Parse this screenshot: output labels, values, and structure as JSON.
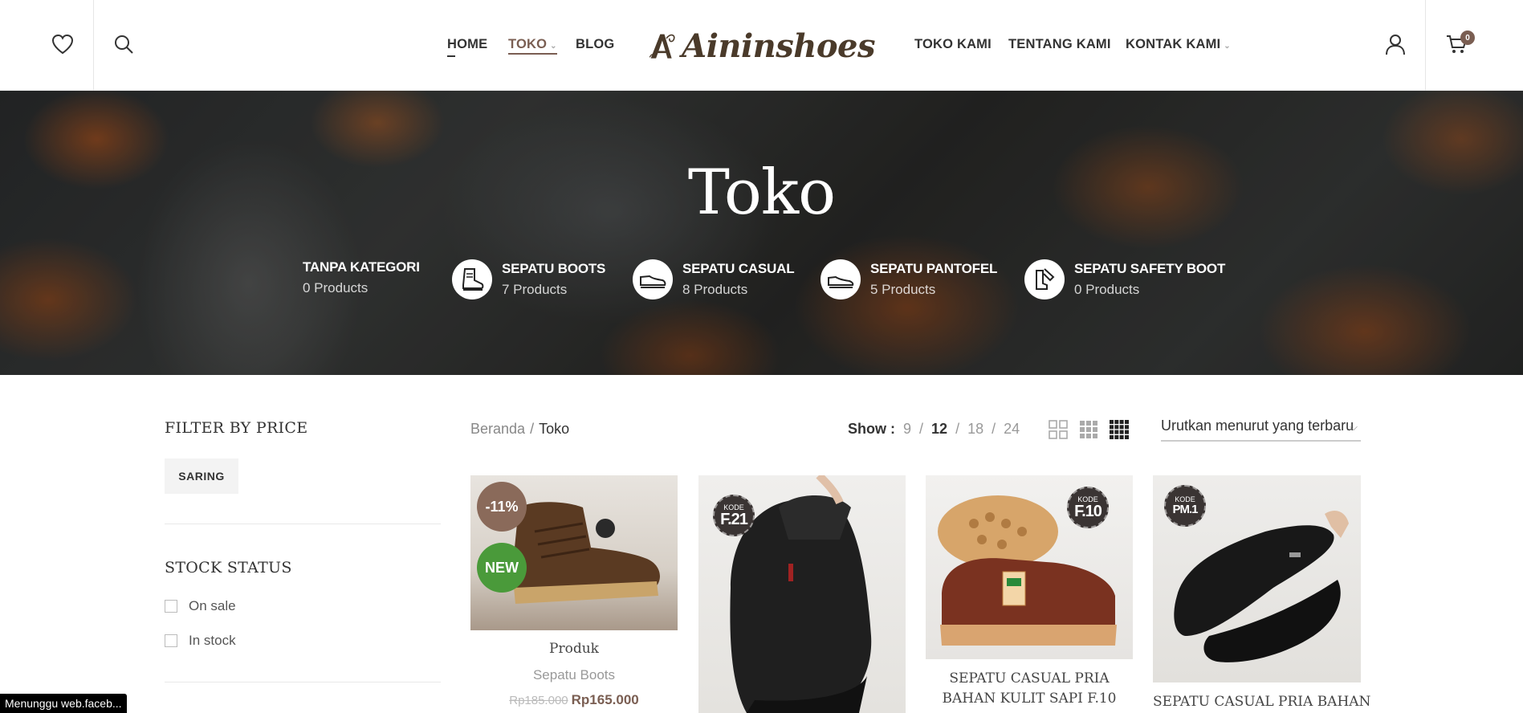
{
  "header": {
    "nav_left": [
      "HOME",
      "TOKO",
      "BLOG"
    ],
    "nav_right": [
      "TOKO KAMI",
      "TENTANG KAMI",
      "KONTAK KAMI"
    ],
    "logo_text": "Aininshoes",
    "cart_count": "0"
  },
  "hero": {
    "title": "Toko",
    "categories": [
      {
        "name": "TANPA KATEGORI",
        "count": "0 Products",
        "icon": "none"
      },
      {
        "name": "SEPATU BOOTS",
        "count": "7 Products",
        "icon": "boot-icon"
      },
      {
        "name": "SEPATU CASUAL",
        "count": "8 Products",
        "icon": "casual-shoe-icon"
      },
      {
        "name": "SEPATU PANTOFEL",
        "count": "5 Products",
        "icon": "pantofel-icon"
      },
      {
        "name": "SEPATU SAFETY BOOT",
        "count": "0 Products",
        "icon": "safety-boot-icon"
      }
    ]
  },
  "sidebar": {
    "filter_price_title": "FILTER BY PRICE",
    "filter_button": "SARING",
    "stock_title": "STOCK STATUS",
    "stock_options": [
      "On sale",
      "In stock"
    ]
  },
  "toolbar": {
    "breadcrumb_home": "Beranda",
    "breadcrumb_sep": "/",
    "breadcrumb_current": "Toko",
    "show_label": "Show :",
    "show_options": [
      "9",
      "12",
      "18",
      "24"
    ],
    "show_selected": "12",
    "sort_label": "Urutkan menurut yang terbaru"
  },
  "products": [
    {
      "title": "Produk",
      "category": "Sepatu Boots",
      "old_price": "Rp185.000",
      "price": "Rp165.000",
      "sale_badge": "-11%",
      "new_badge": "NEW",
      "kode": ""
    },
    {
      "title": "",
      "category": "",
      "old_price": "",
      "price": "",
      "kode": "F.21"
    },
    {
      "title": "SEPATU CASUAL PRIA BAHAN KULIT SAPI F.10",
      "kode": "F.10"
    },
    {
      "title": "SEPATU CASUAL PRIA BAHAN",
      "kode": "PM.1"
    }
  ],
  "kode_label": "KODE",
  "status_bar": "Menunggu web.faceb...",
  "colors": {
    "accent": "#7a5e52",
    "new_badge": "#4a9a3a",
    "sale_badge": "#8a6a5a"
  }
}
